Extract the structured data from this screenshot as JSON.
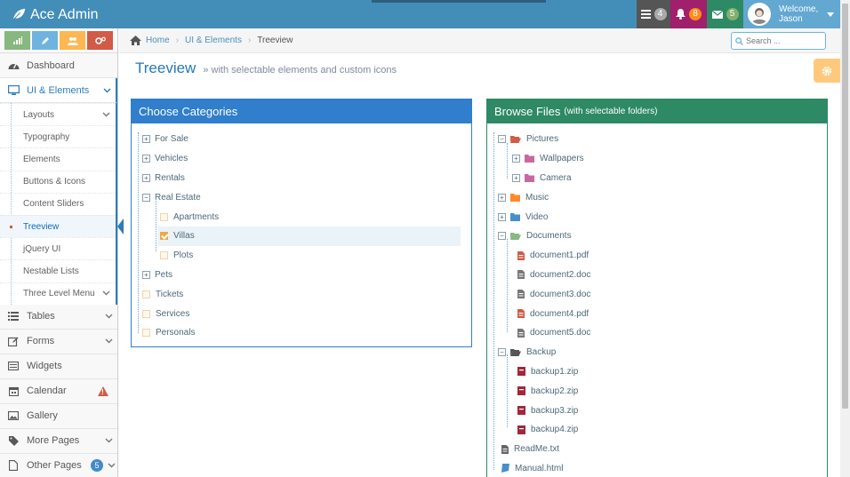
{
  "navbar": {
    "brand": "Ace Admin",
    "tasks_count": "4",
    "notifications_count": "8",
    "messages_count": "5",
    "user_welcome": "Welcome,",
    "user_name": "Jason"
  },
  "colors": {
    "navbar": "#438eb9",
    "tasks": "#555555",
    "notifications": "#a0206b",
    "messages": "#2e8965",
    "user": "#62a8d1",
    "shortcut_success": "#87b87f",
    "shortcut_info": "#6fb3e0",
    "shortcut_warning": "#ffb752",
    "shortcut_danger": "#d15b47"
  },
  "shortcuts": [
    {
      "icon": "signal-icon"
    },
    {
      "icon": "pencil-icon"
    },
    {
      "icon": "users-icon"
    },
    {
      "icon": "cogs-icon"
    }
  ],
  "sidebar": {
    "dashboard": "Dashboard",
    "ui_elements": "UI & Elements",
    "submenu": [
      {
        "label": "Layouts",
        "chevron": true
      },
      {
        "label": "Typography",
        "chevron": false
      },
      {
        "label": "Elements",
        "chevron": false
      },
      {
        "label": "Buttons & Icons",
        "chevron": false
      },
      {
        "label": "Content Sliders",
        "chevron": false
      },
      {
        "label": "Treeview",
        "chevron": false,
        "active": true
      },
      {
        "label": "jQuery UI",
        "chevron": false
      },
      {
        "label": "Nestable Lists",
        "chevron": false
      },
      {
        "label": "Three Level Menu",
        "chevron": true
      }
    ],
    "tables": "Tables",
    "forms": "Forms",
    "widgets": "Widgets",
    "calendar": "Calendar",
    "calendar_badge": "!",
    "gallery": "Gallery",
    "more_pages": "More Pages",
    "other_pages": "Other Pages",
    "other_pages_badge": "5"
  },
  "breadcrumbs": {
    "home": "Home",
    "section": "UI & Elements",
    "current": "Treeview",
    "search_placeholder": "Search ..."
  },
  "page": {
    "title": "Treeview",
    "subtitle": "» with selectable elements and custom icons"
  },
  "categories": {
    "title": "Choose Categories",
    "items": [
      {
        "label": "For Sale",
        "type": "folder",
        "level": 0
      },
      {
        "label": "Vehicles",
        "type": "folder",
        "level": 0
      },
      {
        "label": "Rentals",
        "type": "folder",
        "level": 0
      },
      {
        "label": "Real Estate",
        "type": "folder-open",
        "level": 0
      },
      {
        "label": "Apartments",
        "type": "item",
        "level": 1
      },
      {
        "label": "Villas",
        "type": "item",
        "level": 1,
        "selected": true
      },
      {
        "label": "Plots",
        "type": "item",
        "level": 1
      },
      {
        "label": "Pets",
        "type": "folder",
        "level": 0
      },
      {
        "label": "Tickets",
        "type": "item",
        "level": 0
      },
      {
        "label": "Services",
        "type": "item",
        "level": 0
      },
      {
        "label": "Personals",
        "type": "item",
        "level": 0
      }
    ]
  },
  "files": {
    "title": "Browse Files",
    "title_small": "(with selectable folders)",
    "items": [
      {
        "label": "Pictures",
        "type": "folder-open",
        "level": 0,
        "color": "#d15b47",
        "icon": "folder-open-icon"
      },
      {
        "label": "Wallpapers",
        "type": "folder",
        "level": 1,
        "color": "#c6699f",
        "icon": "folder-icon"
      },
      {
        "label": "Camera",
        "type": "folder",
        "level": 1,
        "color": "#c6699f",
        "icon": "folder-icon"
      },
      {
        "label": "Music",
        "type": "folder",
        "level": 0,
        "color": "#ff892a",
        "icon": "folder-icon"
      },
      {
        "label": "Video",
        "type": "folder",
        "level": 0,
        "color": "#478fca",
        "icon": "folder-icon"
      },
      {
        "label": "Documents",
        "type": "folder-open",
        "level": 0,
        "color": "#87b87f",
        "icon": "folder-open-icon"
      },
      {
        "label": "document1.pdf",
        "type": "file",
        "level": 1,
        "color": "#d15b47",
        "icon": "pdf-file-icon"
      },
      {
        "label": "document2.doc",
        "type": "file",
        "level": 1,
        "color": "#777777",
        "icon": "doc-file-icon"
      },
      {
        "label": "document3.doc",
        "type": "file",
        "level": 1,
        "color": "#777777",
        "icon": "doc-file-icon"
      },
      {
        "label": "document4.pdf",
        "type": "file",
        "level": 1,
        "color": "#d15b47",
        "icon": "pdf-file-icon"
      },
      {
        "label": "document5.doc",
        "type": "file",
        "level": 1,
        "color": "#777777",
        "icon": "doc-file-icon"
      },
      {
        "label": "Backup",
        "type": "folder-open",
        "level": 0,
        "color": "#555555",
        "icon": "folder-open-icon"
      },
      {
        "label": "backup1.zip",
        "type": "file",
        "level": 1,
        "color": "#a0283a",
        "icon": "archive-icon"
      },
      {
        "label": "backup2.zip",
        "type": "file",
        "level": 1,
        "color": "#a0283a",
        "icon": "archive-icon"
      },
      {
        "label": "backup3.zip",
        "type": "file",
        "level": 1,
        "color": "#a0283a",
        "icon": "archive-icon"
      },
      {
        "label": "backup4.zip",
        "type": "file",
        "level": 1,
        "color": "#a0283a",
        "icon": "archive-icon"
      },
      {
        "label": "ReadMe.txt",
        "type": "file",
        "level": 0,
        "color": "#666666",
        "icon": "text-file-icon"
      },
      {
        "label": "Manual.html",
        "type": "file",
        "level": 0,
        "color": "#478fca",
        "icon": "book-icon"
      }
    ]
  }
}
